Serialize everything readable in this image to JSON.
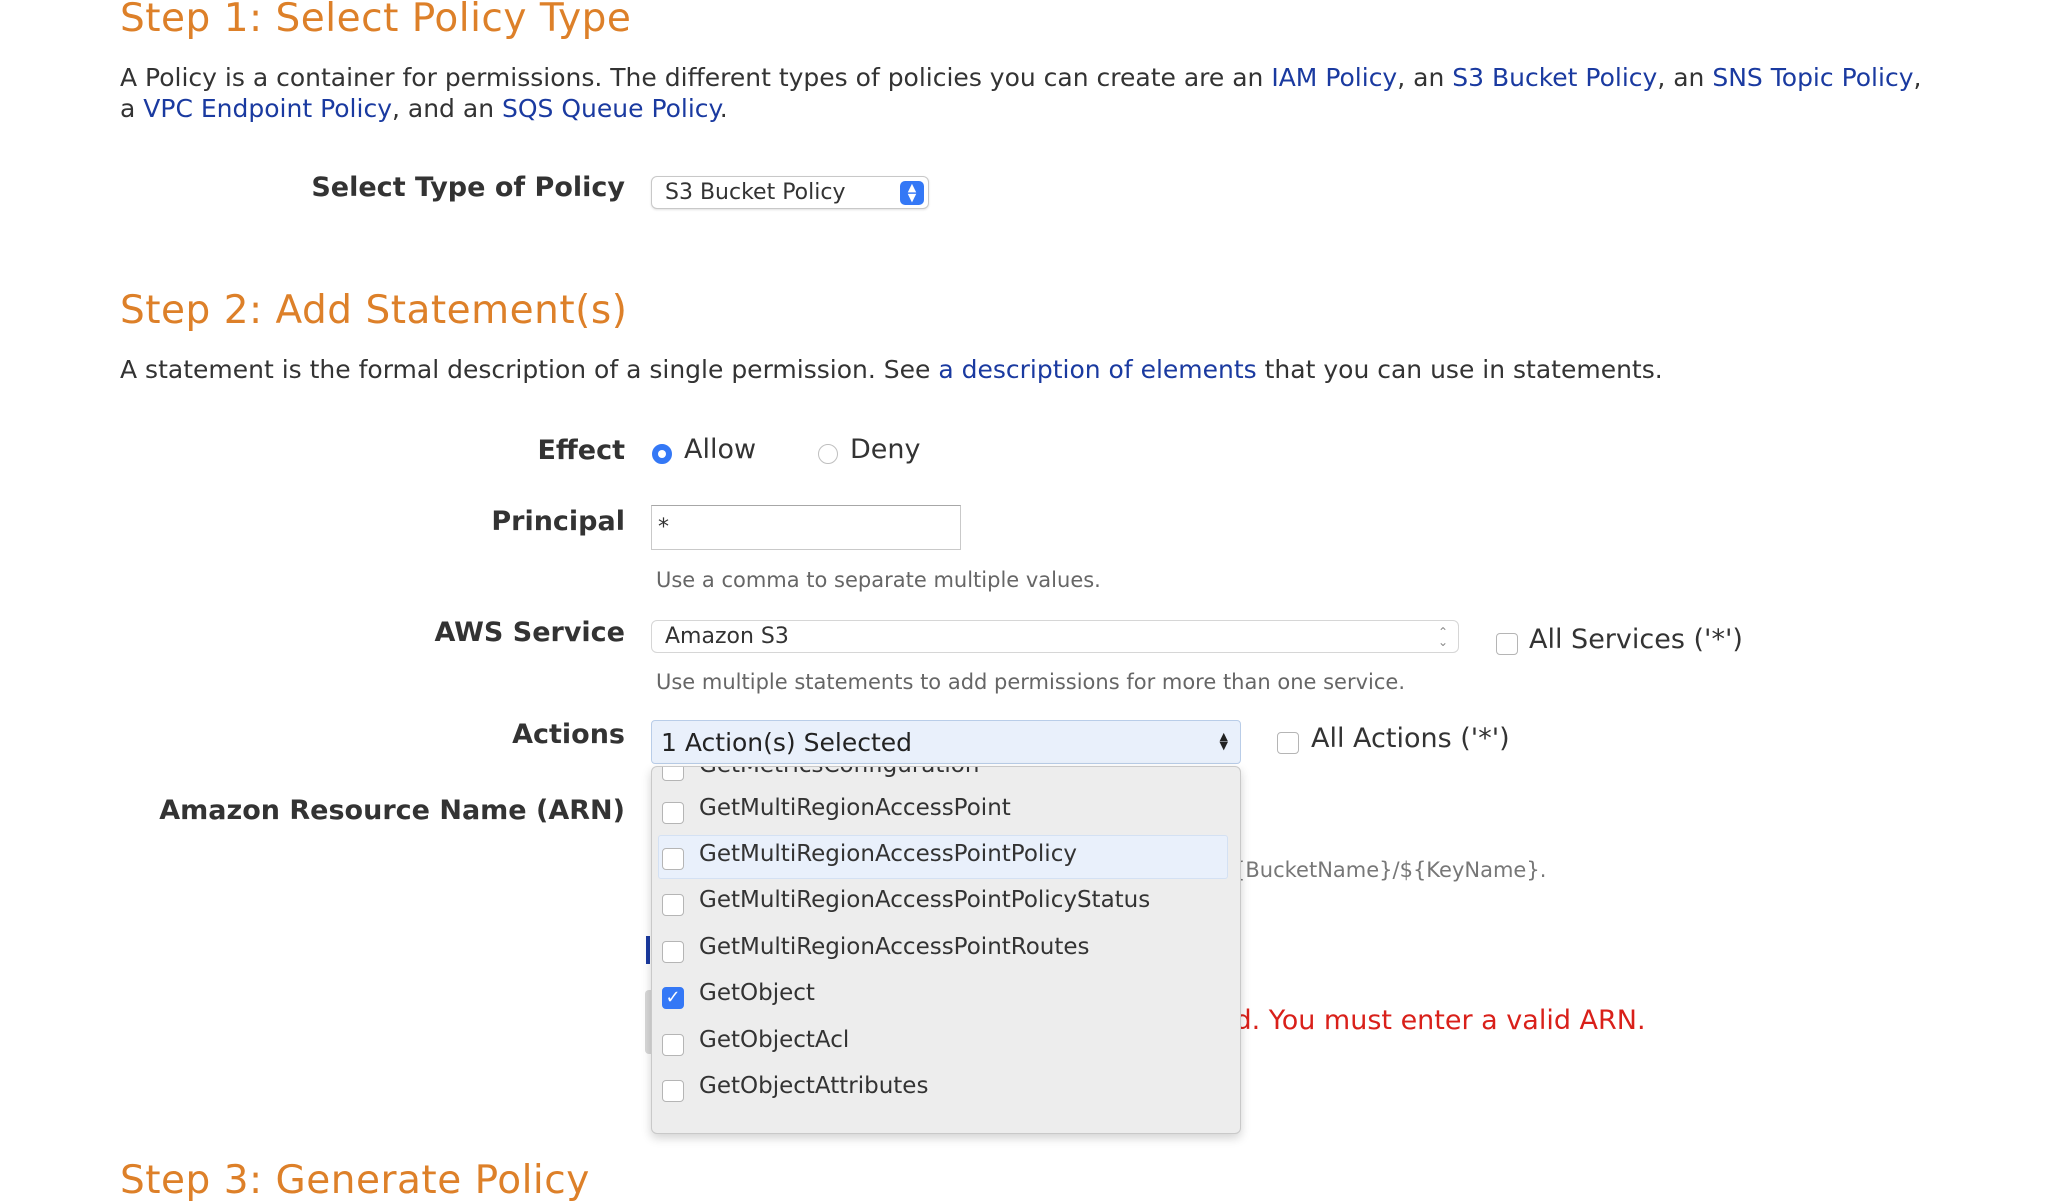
{
  "step1": {
    "title": "Step 1: Select Policy Type",
    "desc_a": "A Policy is a container for permissions. The different types of policies you can create are an ",
    "link_iam": "IAM Policy",
    "sep_an1": ", an ",
    "link_s3": "S3 Bucket Policy",
    "sep_an2": ", an ",
    "link_sns": "SNS Topic Policy",
    "sep_comma": ",",
    "desc_b": "a ",
    "link_vpc": "VPC Endpoint Policy",
    "sep_and": ", and an ",
    "link_sqs": "SQS Queue Policy",
    "period": ".",
    "select_label": "Select Type of Policy",
    "select_value": "S3 Bucket Policy"
  },
  "step2": {
    "title": "Step 2: Add Statement(s)",
    "desc_a": "A statement is the formal description of a single permission. See ",
    "desc_link": "a description of elements",
    "desc_b": " that you can use in statements.",
    "effect_label": "Effect",
    "effect_allow": "Allow",
    "effect_deny": "Deny",
    "principal_label": "Principal",
    "principal_value": "*",
    "principal_hint": "Use a comma to separate multiple values.",
    "service_label": "AWS Service",
    "service_value": "Amazon S3",
    "all_services": "All Services ('*')",
    "service_hint": "Use multiple statements to add permissions for more than one service.",
    "actions_label": "Actions",
    "actions_value": "1 Action(s) Selected",
    "all_actions": "All Actions ('*')",
    "arn_label": "Amazon Resource Name (ARN)",
    "arn_hint_tail": "{BucketName}/${KeyName}.",
    "arn_error": "id. You must enter a valid ARN."
  },
  "actions_dropdown": {
    "items": [
      {
        "label": "GetMetricsConfiguration",
        "checked": false
      },
      {
        "label": "GetMultiRegionAccessPoint",
        "checked": false
      },
      {
        "label": "GetMultiRegionAccessPointPolicy",
        "checked": false
      },
      {
        "label": "GetMultiRegionAccessPointPolicyStatus",
        "checked": false
      },
      {
        "label": "GetMultiRegionAccessPointRoutes",
        "checked": false
      },
      {
        "label": "GetObject",
        "checked": true
      },
      {
        "label": "GetObjectAcl",
        "checked": false
      },
      {
        "label": "GetObjectAttributes",
        "checked": false
      }
    ]
  },
  "step3": {
    "title": "Step 3: Generate Policy"
  },
  "colors": {
    "heading": "#dd8029",
    "link": "#1a3aa0",
    "accent": "#3478f6",
    "error": "#d9201a"
  }
}
